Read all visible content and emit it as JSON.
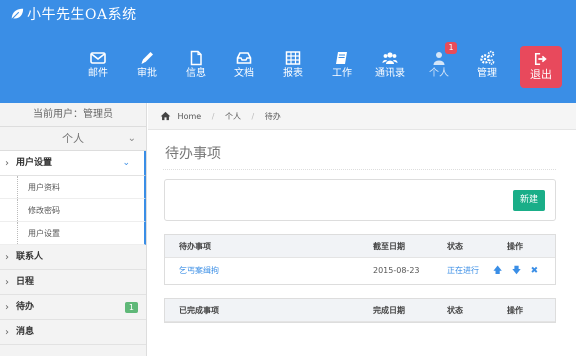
{
  "app": {
    "title": "小牛先生OA系统"
  },
  "nav": {
    "items": [
      {
        "label": "邮件",
        "icon": "envelope-icon"
      },
      {
        "label": "审批",
        "icon": "pencil-icon"
      },
      {
        "label": "信息",
        "icon": "file-icon"
      },
      {
        "label": "文档",
        "icon": "inbox-icon"
      },
      {
        "label": "报表",
        "icon": "table-icon"
      },
      {
        "label": "工作",
        "icon": "book-icon"
      },
      {
        "label": "通讯录",
        "icon": "users-icon"
      },
      {
        "label": "个人",
        "icon": "user-icon",
        "badge": "1"
      },
      {
        "label": "管理",
        "icon": "gears-icon"
      }
    ],
    "logout_label": "退出"
  },
  "sidebar": {
    "current_user": "当前用户：管理员",
    "section_title": "个人",
    "menu": [
      {
        "label": "用户设置",
        "open": true,
        "sub": [
          "用户资料",
          "修改密码",
          "用户设置"
        ]
      },
      {
        "label": "联系人"
      },
      {
        "label": "日程"
      },
      {
        "label": "待办",
        "badge": "1"
      },
      {
        "label": "消息"
      }
    ]
  },
  "breadcrumb": {
    "home": "Home",
    "level1": "个人",
    "level2": "待办"
  },
  "page": {
    "title": "待办事项",
    "new_button": "新建"
  },
  "todo_table": {
    "headers": {
      "name": "待办事项",
      "deadline": "截至日期",
      "status": "状态",
      "actions": "操作"
    },
    "rows": [
      {
        "name": "乞丐案缉拘",
        "deadline": "2015-08-23",
        "status": "正在进行"
      }
    ]
  },
  "done_table": {
    "headers": {
      "name": "已完成事项",
      "date": "完成日期",
      "status": "状态",
      "actions": "操作"
    }
  },
  "colors": {
    "header": "#3a8ee6",
    "logout": "#e8495c",
    "new_button": "#1aae88",
    "badge_green": "#5fb878",
    "badge_red": "#e74c5a"
  }
}
